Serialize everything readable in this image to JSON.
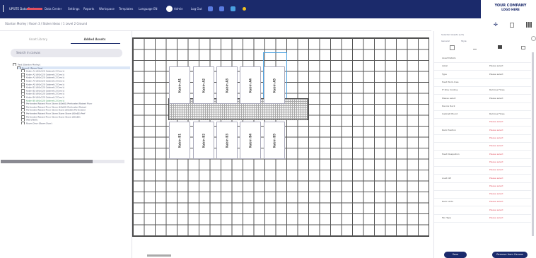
{
  "topbar": {
    "brand": "UPSITE Data Center",
    "items": [
      "Data Center",
      "Settings",
      "Reports",
      "Workspace",
      "Templates",
      "Language EN",
      "Admin",
      "Log Out"
    ]
  },
  "logo": {
    "line1": "YOUR COMPANY",
    "line2": "LOGO HERE"
  },
  "breadcrumb": "Stanton Morley / Room 3 / Stolen Ideas / 1 Level 2 Ground",
  "left_panel": {
    "tabs": [
      "Asset Library",
      "Added Assets"
    ],
    "search_placeholder": "Search in canvas",
    "tree": [
      "Test (Stanton Morley)",
      "Room1 (Room Size)",
      "Kabin A1 (60x120 Cabinet (2 Door))",
      "Kabin A2 (60x120 Cabinet (2 Door))",
      "Kabin A3 (60x120 Cabinet (2 Door))",
      "Kabin A4 (60x120 Cabinet (2 Door))",
      "Kabin A5 (60x120 Cabinet (2 Door))",
      "Kabin B1 (60x120 Cabinet (2 Door))",
      "Kabin B2 (60x120 Cabinet (2 Door))",
      "Kabin B3 (60x120 Cabinet (2 Door))",
      "Kabin B4 (60x120 Cabinet (2 Door))",
      "Kabin B5 (60x120 Cabinet (2 Door))",
      "Perforated Raised Floor Stone (60x60) Perforated Raised Floor",
      "Perforated Raised Floor Stone (60x60) Perforated Raised",
      "Perforated Raised Floor Stone Stone (60x60) Perforated",
      "Perforated Raised Floor Stone Stone Stone (60x60) Perf",
      "Perforated Raised Floor Stone Stone Stone (60x60)",
      "Wall (Wall)",
      "Room Door (Room Door)"
    ]
  },
  "cabinets_top": [
    "Kabin A1",
    "Kabin A2",
    "Kabin A3",
    "Kabin A4",
    "Kabin A5"
  ],
  "cabinets_bottom": [
    "Kabin B1",
    "Kabin B2",
    "Kabin B3",
    "Kabin B4",
    "Kabin B5"
  ],
  "right_panel": {
    "title": "Selected Assets (1/5)",
    "tabs": [
      "General",
      "Style"
    ],
    "rows": [
      {
        "left": "Asset Details",
        "right": ""
      },
      {
        "left": "Label",
        "right": "Please select"
      },
      {
        "left": "Type",
        "right": "Please select"
      },
      {
        "left": "Heat Work Area",
        "right": ""
      },
      {
        "left": "IT Row Cooling",
        "right": "Remove Flows"
      },
      {
        "left": "Please select",
        "right": "Please select"
      },
      {
        "left": "Device Rack",
        "right": ""
      },
      {
        "left": "Cabinet Mount",
        "right": "Remove Flows"
      },
      {
        "left": "",
        "right": "Please select"
      },
      {
        "left": "Rack Position",
        "right": "Please select"
      },
      {
        "left": "",
        "right": "Please select"
      },
      {
        "left": "",
        "right": "Please select"
      },
      {
        "left": "Heat Dissipation",
        "right": "Please select"
      },
      {
        "left": "",
        "right": "Please select"
      },
      {
        "left": "",
        "right": "Please select"
      },
      {
        "left": "Load kW",
        "right": "Please select"
      },
      {
        "left": "",
        "right": "Please select"
      },
      {
        "left": "",
        "right": "Please select"
      },
      {
        "left": "Rack Units",
        "right": "Please select"
      },
      {
        "left": "",
        "right": "Please select"
      },
      {
        "left": "Fan Type",
        "right": "Please select"
      }
    ],
    "buttons": [
      "Save",
      "Remove from Canvas"
    ]
  },
  "colors": {
    "nav": "#1b2a6b",
    "accent": "#e05060",
    "highlight": "#4fa3e0"
  }
}
